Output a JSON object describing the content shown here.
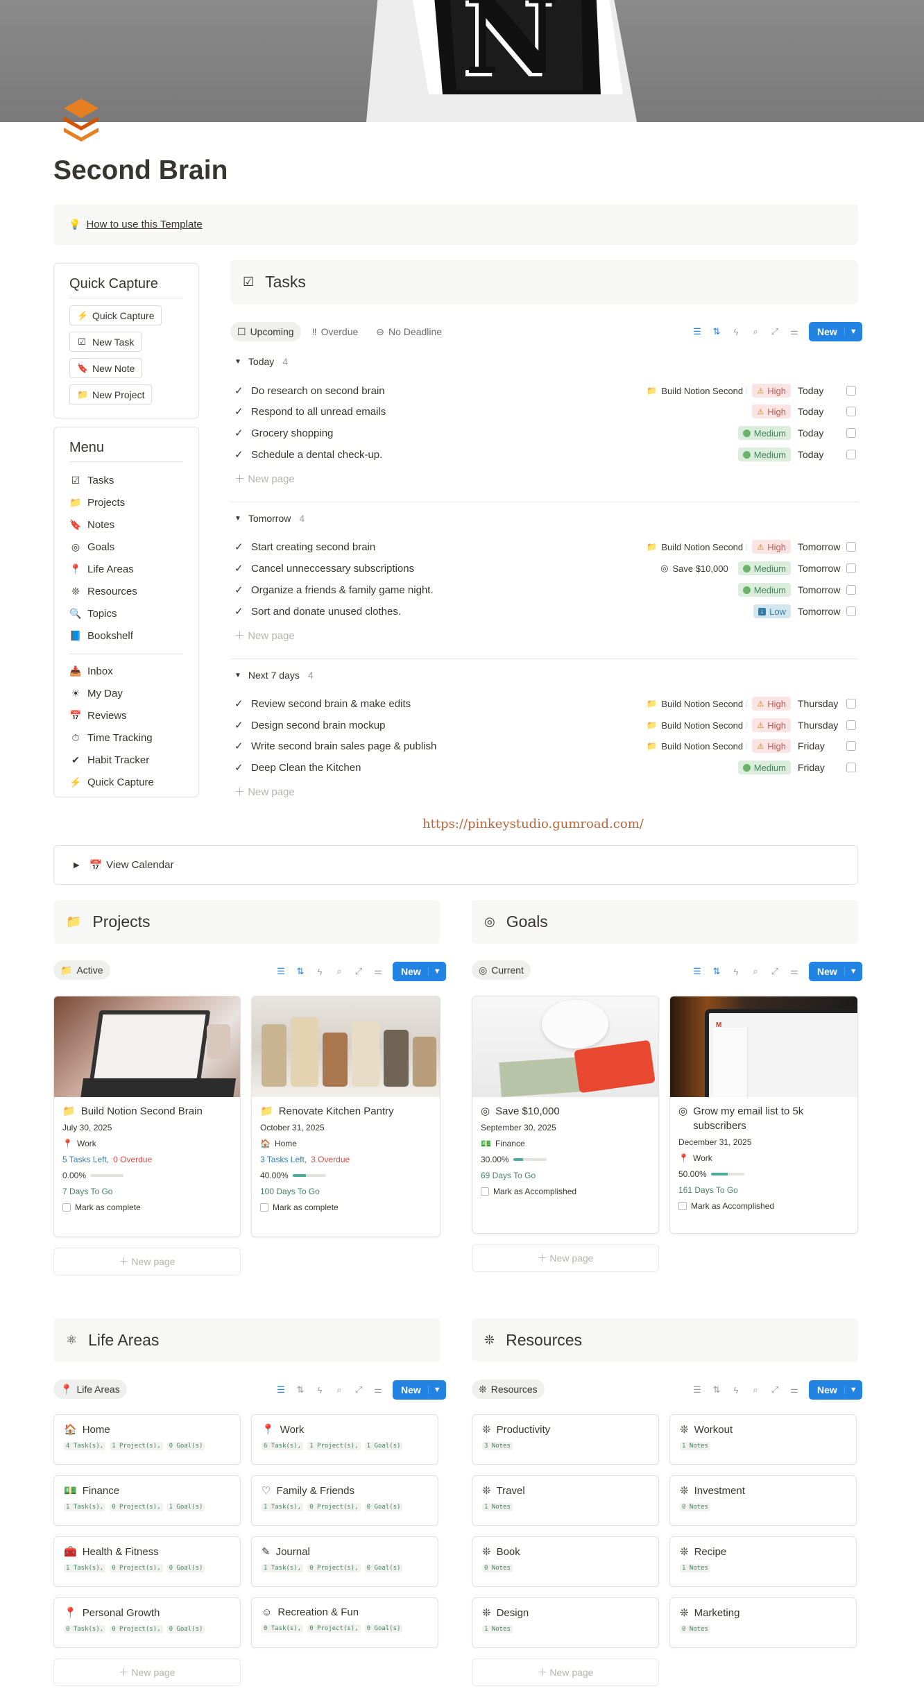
{
  "page": {
    "title": "Second Brain"
  },
  "howto": {
    "icon": "lightbulb-icon",
    "label": "How to use this Template"
  },
  "quick_capture": {
    "title": "Quick Capture",
    "buttons": [
      {
        "icon": "bolt-icon",
        "label": "Quick Capture"
      },
      {
        "icon": "checkbox-icon",
        "label": "New Task"
      },
      {
        "icon": "bookmark-icon",
        "label": "New Note"
      },
      {
        "icon": "folder-icon",
        "label": "New Project"
      }
    ]
  },
  "menu": {
    "title": "Menu",
    "items": [
      "Tasks",
      "Projects",
      "Notes",
      "Goals",
      "Life Areas",
      "Resources",
      "Topics",
      "Bookshelf"
    ],
    "items2": [
      "Inbox",
      "My Day",
      "Reviews",
      "Time Tracking",
      "Habit Tracker",
      "Quick Capture"
    ]
  },
  "tasks": {
    "title": "Tasks",
    "tabs": [
      "Upcoming",
      "Overdue",
      "No Deadline"
    ],
    "new_label": "New",
    "new_page": "New page",
    "groups": [
      {
        "name": "Today",
        "count": "4",
        "rows": [
          {
            "name": "Do research on second brain",
            "project": "Build Notion Second Brain",
            "goal": "",
            "priority": "High",
            "due": "Today"
          },
          {
            "name": "Respond to all unread emails",
            "project": "",
            "goal": "",
            "priority": "High",
            "due": "Today"
          },
          {
            "name": "Grocery shopping",
            "project": "",
            "goal": "",
            "priority": "Medium",
            "due": "Today"
          },
          {
            "name": "Schedule a dental check-up.",
            "project": "",
            "goal": "",
            "priority": "Medium",
            "due": "Today"
          }
        ]
      },
      {
        "name": "Tomorrow",
        "count": "4",
        "rows": [
          {
            "name": "Start creating second brain",
            "project": "Build Notion Second Brain",
            "goal": "",
            "priority": "High",
            "due": "Tomorrow"
          },
          {
            "name": "Cancel unneccessary subscriptions",
            "project": "",
            "goal": "Save $10,000",
            "priority": "Medium",
            "due": "Tomorrow"
          },
          {
            "name": "Organize a friends & family game night.",
            "project": "",
            "goal": "",
            "priority": "Medium",
            "due": "Tomorrow"
          },
          {
            "name": "Sort and donate unused clothes.",
            "project": "",
            "goal": "",
            "priority": "Low",
            "due": "Tomorrow"
          }
        ]
      },
      {
        "name": "Next 7 days",
        "count": "4",
        "rows": [
          {
            "name": "Review second brain & make edits",
            "project": "Build Notion Second Brain",
            "goal": "",
            "priority": "High",
            "due": "Thursday"
          },
          {
            "name": "Design second brain mockup",
            "project": "Build Notion Second Brain",
            "goal": "",
            "priority": "High",
            "due": "Thursday"
          },
          {
            "name": "Write second brain sales page & publish",
            "project": "Build Notion Second Brain",
            "goal": "",
            "priority": "High",
            "due": "Friday"
          },
          {
            "name": "Deep Clean the Kitchen",
            "project": "",
            "goal": "",
            "priority": "Medium",
            "due": "Friday"
          }
        ]
      }
    ]
  },
  "gumroad": "https://pinkeystudio.gumroad.com/",
  "calendar": {
    "icon": "calendar-icon",
    "label": "View Calendar"
  },
  "projects": {
    "title": "Projects",
    "tab": "Active",
    "new_label": "New",
    "new_page": "New page",
    "cards": [
      {
        "title": "Build Notion Second Brain",
        "date": "July 30, 2025",
        "area": "Work",
        "tasks_left": "5 Tasks Left,",
        "overdue": "0 Overdue",
        "progress_text": "0.00%",
        "progress": 0,
        "days": "7 Days To Go",
        "check": "Mark as complete"
      },
      {
        "title": "Renovate Kitchen Pantry",
        "date": "October 31, 2025",
        "area": "Home",
        "tasks_left": "3 Tasks Left,",
        "overdue": "3 Overdue",
        "progress_text": "40.00%",
        "progress": 0.4,
        "days": "100 Days To Go",
        "check": "Mark as complete"
      }
    ]
  },
  "goals": {
    "title": "Goals",
    "tab": "Current",
    "new_label": "New",
    "new_page": "New page",
    "cards": [
      {
        "title": "Save $10,000",
        "date": "September 30, 2025",
        "area": "Finance",
        "progress_text": "30.00%",
        "progress": 0.3,
        "days": "69 Days To Go",
        "check": "Mark as Accomplished"
      },
      {
        "title": "Grow my email list to 5k subscribers",
        "date": "December 31, 2025",
        "area": "Work",
        "progress_text": "50.00%",
        "progress": 0.5,
        "days": "161 Days To Go",
        "check": "Mark as Accomplished"
      }
    ]
  },
  "life_areas": {
    "title": "Life Areas",
    "tab": "Life Areas",
    "new_label": "New",
    "new_page": "New page",
    "items": [
      {
        "name": "Home",
        "icon": "home-icon",
        "tasks": "4 Task(s),",
        "projects": "1 Project(s),",
        "goals": "0 Goal(s)"
      },
      {
        "name": "Work",
        "icon": "pin-icon",
        "tasks": "6 Task(s),",
        "projects": "1 Project(s),",
        "goals": "1 Goal(s)"
      },
      {
        "name": "Finance",
        "icon": "money-icon",
        "tasks": "1 Task(s),",
        "projects": "0 Project(s),",
        "goals": "1 Goal(s)"
      },
      {
        "name": "Family & Friends",
        "icon": "heart-icon",
        "tasks": "1 Task(s),",
        "projects": "0 Project(s),",
        "goals": "0 Goal(s)"
      },
      {
        "name": "Health & Fitness",
        "icon": "medkit-icon",
        "tasks": "1 Task(s),",
        "projects": "0 Project(s),",
        "goals": "0 Goal(s)"
      },
      {
        "name": "Journal",
        "icon": "edit-icon",
        "tasks": "1 Task(s),",
        "projects": "0 Project(s),",
        "goals": "0 Goal(s)"
      },
      {
        "name": "Personal Growth",
        "icon": "pin-icon",
        "tasks": "0 Task(s),",
        "projects": "0 Project(s),",
        "goals": "0 Goal(s)"
      },
      {
        "name": "Recreation & Fun",
        "icon": "smile-icon",
        "tasks": "0 Task(s),",
        "projects": "0 Project(s),",
        "goals": "0 Goal(s)"
      }
    ]
  },
  "resources": {
    "title": "Resources",
    "tab": "Resources",
    "new_label": "New",
    "new_page": "New page",
    "items": [
      {
        "name": "Productivity",
        "notes": "3 Notes"
      },
      {
        "name": "Workout",
        "notes": "1 Notes"
      },
      {
        "name": "Travel",
        "notes": "1 Notes"
      },
      {
        "name": "Investment",
        "notes": "0 Notes"
      },
      {
        "name": "Book",
        "notes": "0 Notes"
      },
      {
        "name": "Recipe",
        "notes": "1 Notes"
      },
      {
        "name": "Design",
        "notes": "1 Notes"
      },
      {
        "name": "Marketing",
        "notes": "0 Notes"
      }
    ]
  },
  "colors": {
    "accent": "#2383e2",
    "high": "#c4554d",
    "medium": "#448361",
    "low": "#337ea9",
    "page_bg": "#ffffff",
    "block_bg": "#f7f7f5"
  }
}
